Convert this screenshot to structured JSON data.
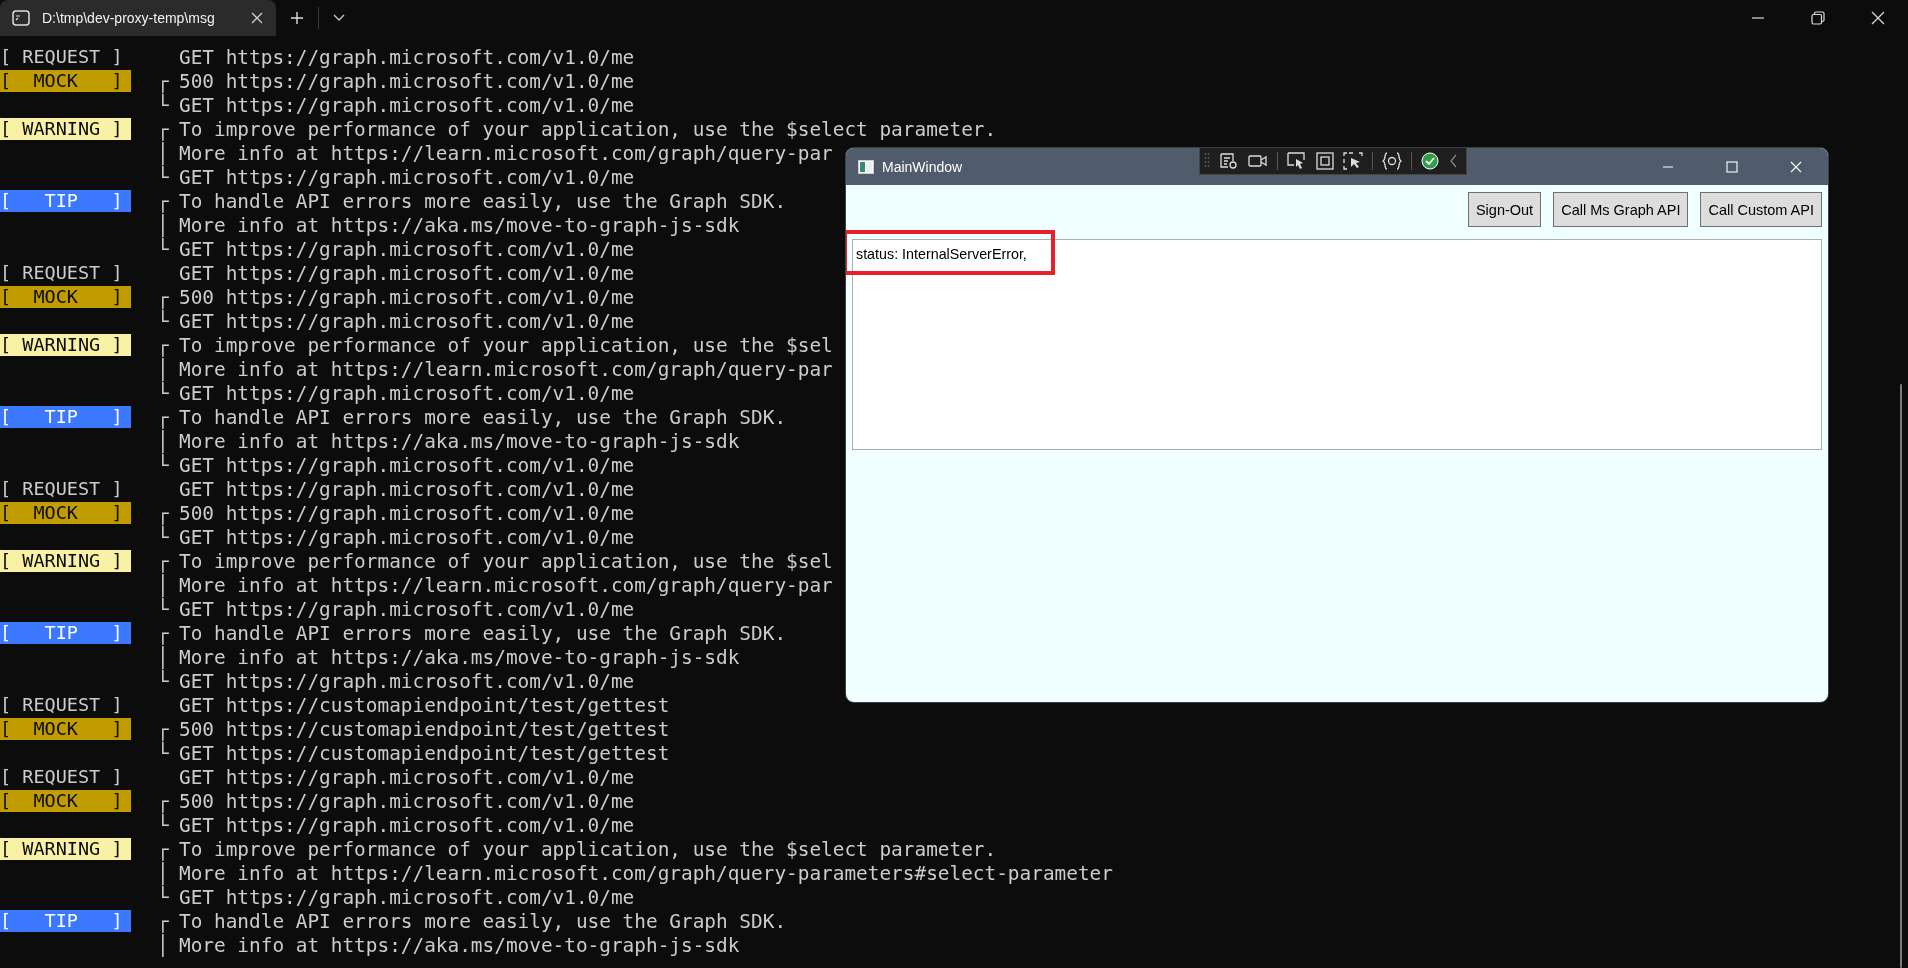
{
  "tab_bar": {
    "tab": {
      "title": "D:\\tmp\\dev-proxy-temp\\msg",
      "selected": true
    }
  },
  "terminal": {
    "lines": [
      {
        "badge": {
          "kind": "request",
          "label": "[ REQUEST ]"
        },
        "text": "GET https://graph.microsoft.com/v1.0/me"
      },
      {
        "badge": {
          "kind": "mock",
          "label": "[  MOCK   ]"
        },
        "bracket": "┌",
        "text": "500 https://graph.microsoft.com/v1.0/me"
      },
      {
        "bracket": "└",
        "text": "GET https://graph.microsoft.com/v1.0/me"
      },
      {
        "badge": {
          "kind": "warning",
          "label": "[ WARNING ]"
        },
        "bracket": "┌",
        "text": "To improve performance of your application, use the $select parameter."
      },
      {
        "bracket": "│",
        "text": "More info at https://learn.microsoft.com/graph/query-par"
      },
      {
        "bracket": "└",
        "text": "GET https://graph.microsoft.com/v1.0/me"
      },
      {
        "badge": {
          "kind": "tip",
          "label": "[   TIP   ]"
        },
        "bracket": "┌",
        "text": "To handle API errors more easily, use the Graph SDK."
      },
      {
        "bracket": "│",
        "text": "More info at https://aka.ms/move-to-graph-js-sdk"
      },
      {
        "bracket": "└",
        "text": "GET https://graph.microsoft.com/v1.0/me"
      },
      {
        "badge": {
          "kind": "request",
          "label": "[ REQUEST ]"
        },
        "text": "GET https://graph.microsoft.com/v1.0/me"
      },
      {
        "badge": {
          "kind": "mock",
          "label": "[  MOCK   ]"
        },
        "bracket": "┌",
        "text": "500 https://graph.microsoft.com/v1.0/me"
      },
      {
        "bracket": "└",
        "text": "GET https://graph.microsoft.com/v1.0/me"
      },
      {
        "badge": {
          "kind": "warning",
          "label": "[ WARNING ]"
        },
        "bracket": "┌",
        "text": "To improve performance of your application, use the $sel"
      },
      {
        "bracket": "│",
        "text": "More info at https://learn.microsoft.com/graph/query-par"
      },
      {
        "bracket": "└",
        "text": "GET https://graph.microsoft.com/v1.0/me"
      },
      {
        "badge": {
          "kind": "tip",
          "label": "[   TIP   ]"
        },
        "bracket": "┌",
        "text": "To handle API errors more easily, use the Graph SDK."
      },
      {
        "bracket": "│",
        "text": "More info at https://aka.ms/move-to-graph-js-sdk"
      },
      {
        "bracket": "└",
        "text": "GET https://graph.microsoft.com/v1.0/me"
      },
      {
        "badge": {
          "kind": "request",
          "label": "[ REQUEST ]"
        },
        "text": "GET https://graph.microsoft.com/v1.0/me"
      },
      {
        "badge": {
          "kind": "mock",
          "label": "[  MOCK   ]"
        },
        "bracket": "┌",
        "text": "500 https://graph.microsoft.com/v1.0/me"
      },
      {
        "bracket": "└",
        "text": "GET https://graph.microsoft.com/v1.0/me"
      },
      {
        "badge": {
          "kind": "warning",
          "label": "[ WARNING ]"
        },
        "bracket": "┌",
        "text": "To improve performance of your application, use the $sel"
      },
      {
        "bracket": "│",
        "text": "More info at https://learn.microsoft.com/graph/query-par"
      },
      {
        "bracket": "└",
        "text": "GET https://graph.microsoft.com/v1.0/me"
      },
      {
        "badge": {
          "kind": "tip",
          "label": "[   TIP   ]"
        },
        "bracket": "┌",
        "text": "To handle API errors more easily, use the Graph SDK."
      },
      {
        "bracket": "│",
        "text": "More info at https://aka.ms/move-to-graph-js-sdk"
      },
      {
        "bracket": "└",
        "text": "GET https://graph.microsoft.com/v1.0/me"
      },
      {
        "badge": {
          "kind": "request",
          "label": "[ REQUEST ]"
        },
        "text": "GET https://customapiendpoint/test/gettest"
      },
      {
        "badge": {
          "kind": "mock",
          "label": "[  MOCK   ]"
        },
        "bracket": "┌",
        "text": "500 https://customapiendpoint/test/gettest"
      },
      {
        "bracket": "└",
        "text": "GET https://customapiendpoint/test/gettest"
      },
      {
        "badge": {
          "kind": "request",
          "label": "[ REQUEST ]"
        },
        "text": "GET https://graph.microsoft.com/v1.0/me"
      },
      {
        "badge": {
          "kind": "mock",
          "label": "[  MOCK   ]"
        },
        "bracket": "┌",
        "text": "500 https://graph.microsoft.com/v1.0/me"
      },
      {
        "bracket": "└",
        "text": "GET https://graph.microsoft.com/v1.0/me"
      },
      {
        "badge": {
          "kind": "warning",
          "label": "[ WARNING ]"
        },
        "bracket": "┌",
        "text": "To improve performance of your application, use the $select parameter."
      },
      {
        "bracket": "│",
        "text": "More info at https://learn.microsoft.com/graph/query-parameters#select-parameter"
      },
      {
        "bracket": "└",
        "text": "GET https://graph.microsoft.com/v1.0/me"
      },
      {
        "badge": {
          "kind": "tip",
          "label": "[   TIP   ]"
        },
        "bracket": "┌",
        "text": "To handle API errors more easily, use the Graph SDK."
      },
      {
        "bracket": "│",
        "text": "More info at https://aka.ms/move-to-graph-js-sdk"
      }
    ]
  },
  "app_window": {
    "title": "MainWindow",
    "buttons": [
      "Sign-Out",
      "Call Ms Graph API",
      "Call Custom API"
    ],
    "output": {
      "value": "status: InternalServerError,",
      "highlighted": true
    }
  }
}
